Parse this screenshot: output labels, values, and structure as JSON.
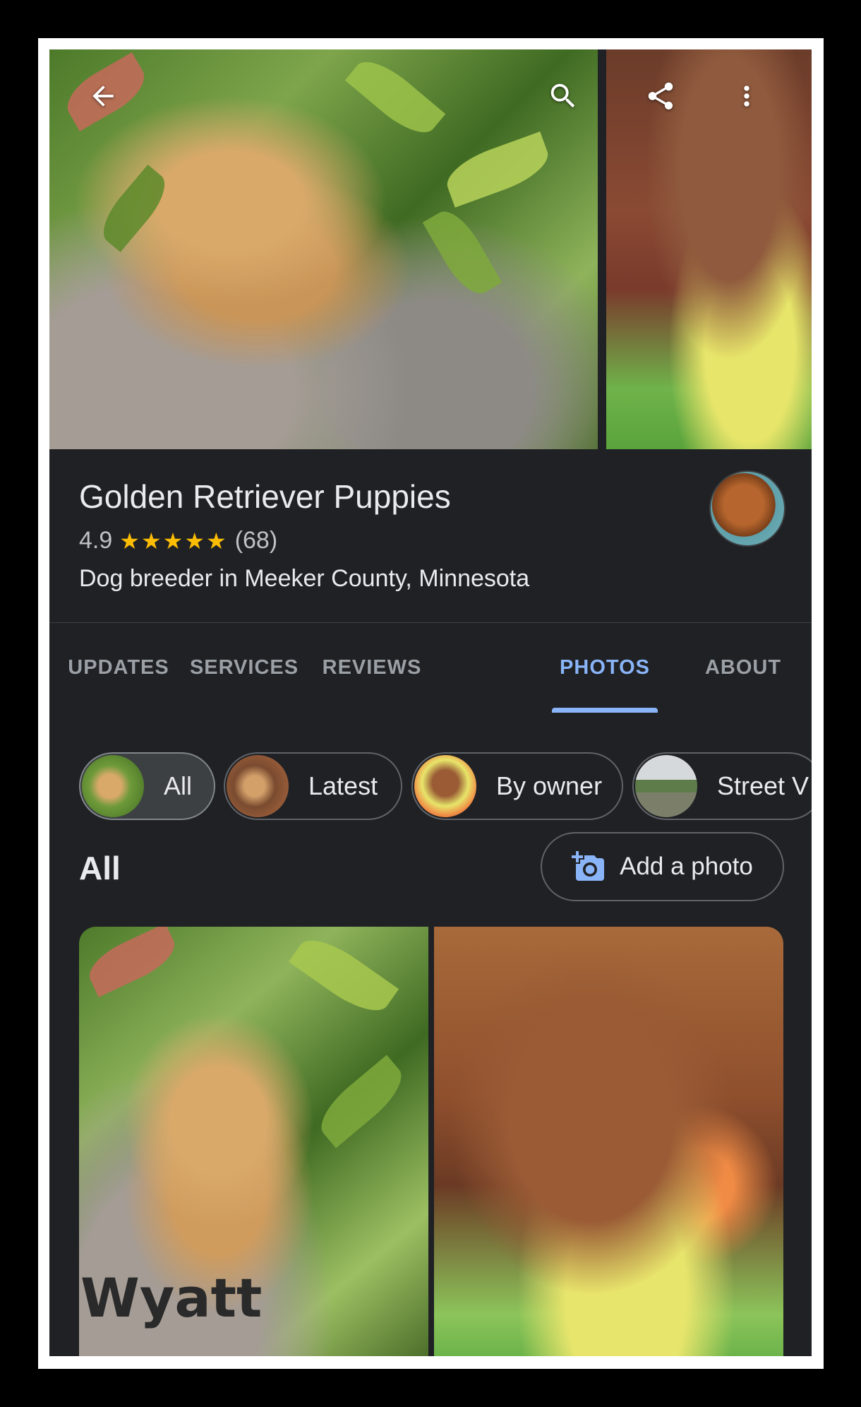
{
  "business": {
    "name": "Golden Retriever Puppies",
    "rating": "4.9",
    "stars": "★★★★★",
    "review_count": "(68)",
    "category": "Dog breeder in Meeker County, Minnesota"
  },
  "tabs": [
    {
      "label": "UPDATES",
      "active": false
    },
    {
      "label": "SERVICES",
      "active": false
    },
    {
      "label": "REVIEWS",
      "active": false
    },
    {
      "label": "PHOTOS",
      "active": true
    },
    {
      "label": "ABOUT",
      "active": false
    }
  ],
  "chips": [
    {
      "label": "All",
      "selected": true
    },
    {
      "label": "Latest",
      "selected": false
    },
    {
      "label": "By owner",
      "selected": false
    },
    {
      "label": "Street V",
      "selected": false
    }
  ],
  "section": {
    "title": "All",
    "add_photo_label": "Add a photo"
  },
  "photos": {
    "watermark": "Wyatt"
  },
  "icons": {
    "back": "arrow-left-icon",
    "search": "search-icon",
    "share": "share-icon",
    "more": "more-vert-icon",
    "add_photo": "add-photo-icon"
  },
  "colors": {
    "background": "#202124",
    "accent": "#8ab4f8",
    "star": "#fbbc04",
    "text_primary": "#e8eaed",
    "text_secondary": "#9aa0a6"
  }
}
